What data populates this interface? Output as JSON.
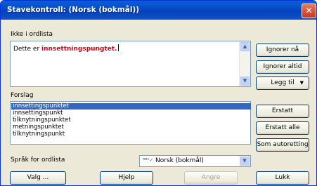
{
  "window": {
    "title": "Stavekontroll: (Norsk (bokmål))"
  },
  "not_in_dictionary": {
    "label": "Ikke i ordlista",
    "text_before": "Dette er ",
    "error_word": "innsettningspungtet."
  },
  "suggestions": {
    "label": "Forslag",
    "items": [
      "innsettingspunktet",
      "innsettingspunkt",
      "tilknytningspunktet",
      "metningspunktet",
      "tilknytningspunkt"
    ],
    "selected_index": 0
  },
  "language": {
    "label": "Språk for ordlista",
    "value": "Norsk (bokmål)",
    "icon": "abc-icon"
  },
  "buttons": {
    "ignore_once": "Ignorer nå",
    "ignore_all": "Ignorer altid",
    "add_to": "Legg til",
    "replace": "Erstatt",
    "replace_all": "Erstatt alle",
    "autocorrect": "Som autoretting",
    "options": "Valg ...",
    "help": "Hjelp",
    "undo": "Angre",
    "close": "Lukk"
  }
}
